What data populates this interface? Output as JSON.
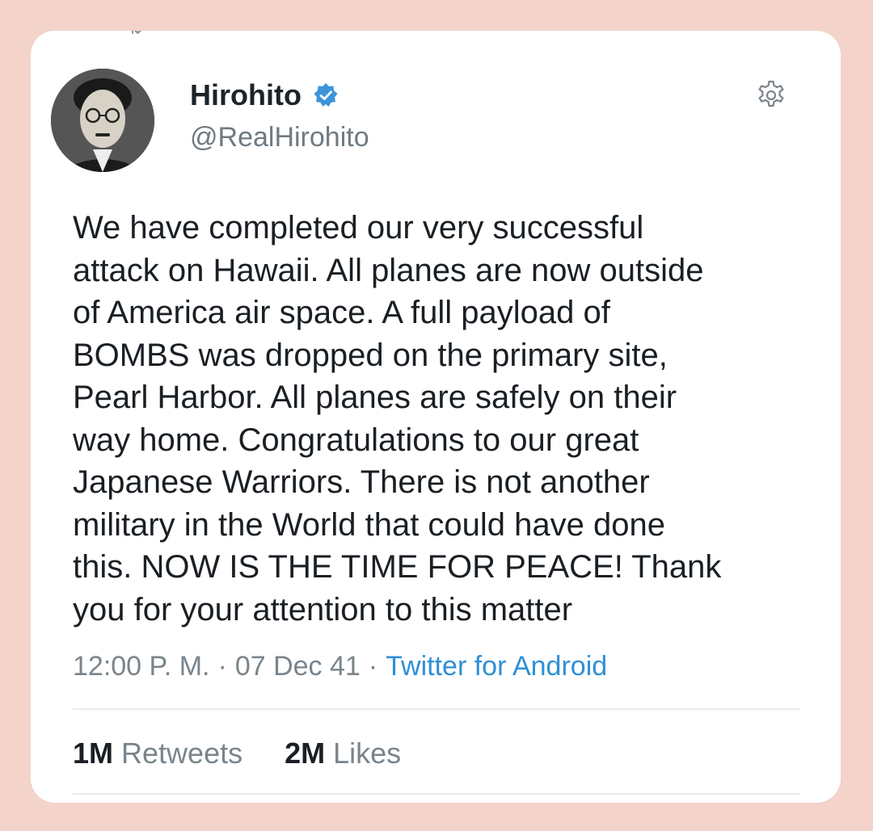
{
  "author": {
    "display_name": "Hirohito",
    "handle": "@RealHirohito",
    "verified": true
  },
  "tweet": {
    "text": "We have completed our very successful\nattack on Hawaii. All planes are now outside\nof America air space. A full payload of\nBOMBS was dropped on the primary site,\nPearl Harbor. All planes are safely on their\nway home. Congratulations to our great\nJapanese Warriors. There is not another\nmilitary in the World that could have done\nthis. NOW IS THE TIME FOR PEACE! Thank\nyou for your attention to this matter",
    "time": "12:00 P. M.",
    "date": "07 Dec 41",
    "separator": "·",
    "source": "Twitter for Android"
  },
  "stats": {
    "retweets_count": "1M",
    "retweets_label": "Retweets",
    "likes_count": "2M",
    "likes_label": "Likes"
  },
  "icons": {
    "verified": "verified-badge-icon",
    "settings": "gear-icon",
    "retweet": "retweet-icon"
  },
  "colors": {
    "page_background": "#f3d3ca",
    "verified_blue": "#3b94d9",
    "link_blue": "#2f8fd6",
    "muted_text": "#7a848b"
  }
}
